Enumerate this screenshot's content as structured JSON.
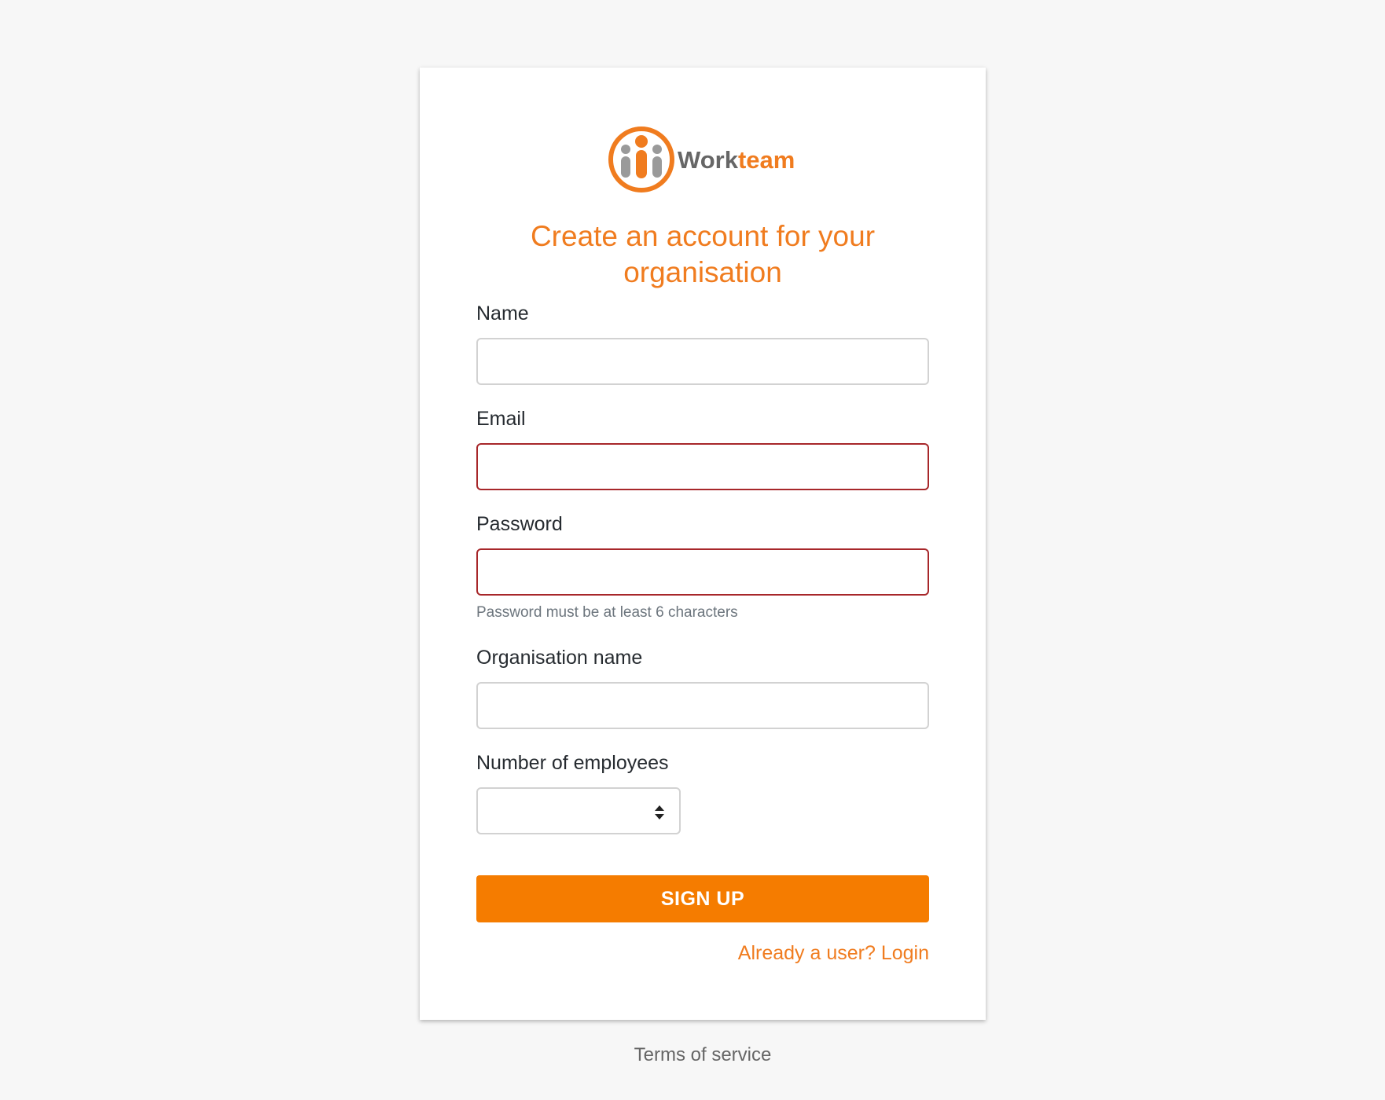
{
  "brand": {
    "name_part1": "Work",
    "name_part2": "team",
    "accent_color": "#f07c1f",
    "logo_icon": "people-logo-icon"
  },
  "page": {
    "title_line1": "Create an account for your",
    "title_line2": "organisation"
  },
  "form": {
    "name_label": "Name",
    "name_value": "",
    "email_label": "Email",
    "email_value": "",
    "password_label": "Password",
    "password_value": "",
    "password_hint": "Password must be at least 6 characters",
    "org_label": "Organisation name",
    "org_value": "",
    "employees_label": "Number of employees",
    "employees_value": "",
    "submit_label": "SIGN UP",
    "login_link": "Already a user? Login",
    "error_color": "#a7272a",
    "button_color": "#f57c00"
  },
  "footer": {
    "terms_link": "Terms of service"
  }
}
